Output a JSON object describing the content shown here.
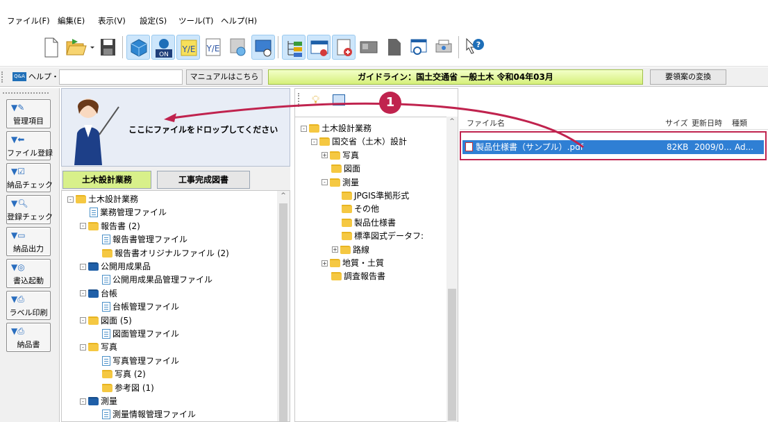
{
  "menu": [
    "ファイル(F)",
    "編集(E)",
    "表示(V)",
    "設定(S)",
    "ツール(T)",
    "ヘルプ(H)"
  ],
  "guidebar": {
    "help_label": "ヘルプ・FAQ検索",
    "qa_badge": "Q&A",
    "manual_button": "マニュアルはこちら",
    "guideline_text": "ガイドライン：国土交通省 一般土木 令和04年03月",
    "convert_button": "要領案の変換"
  },
  "sidebar": [
    {
      "label": "管理項目",
      "icon": "edit-icon"
    },
    {
      "label": "ファイル登録",
      "icon": "register-icon"
    },
    {
      "label": "納品チェック",
      "icon": "checkbox-icon"
    },
    {
      "label": "登録チェック",
      "icon": "magnifier-icon"
    },
    {
      "label": "納品出力",
      "icon": "drive-icon"
    },
    {
      "label": "書込起動",
      "icon": "disc-icon"
    },
    {
      "label": "ラベル印刷",
      "icon": "printer-icon"
    },
    {
      "label": "納品書",
      "icon": "printer-icon"
    }
  ],
  "drop": {
    "text": "ここにファイルをドロップしてください"
  },
  "tabs": [
    {
      "label": "土木設計業務",
      "active": true
    },
    {
      "label": "工事完成図書",
      "active": false
    }
  ],
  "left_tree": [
    {
      "label": "土木設計業務",
      "type": "folder",
      "indent": 0,
      "exp": "-"
    },
    {
      "label": "業務管理ファイル",
      "type": "doc",
      "indent": 1
    },
    {
      "label": "報告書 (2)",
      "type": "folder",
      "indent": 1,
      "exp": "-"
    },
    {
      "label": "報告書管理ファイル",
      "type": "doc",
      "indent": 2
    },
    {
      "label": "報告書オリジナルファイル (2)",
      "type": "folder",
      "indent": 2
    },
    {
      "label": "公開用成果品",
      "type": "folder-blue",
      "indent": 1,
      "exp": "-"
    },
    {
      "label": "公開用成果品管理ファイル",
      "type": "doc",
      "indent": 2
    },
    {
      "label": "台帳",
      "type": "folder-blue",
      "indent": 1,
      "exp": "-"
    },
    {
      "label": "台帳管理ファイル",
      "type": "doc",
      "indent": 2
    },
    {
      "label": "図面 (5)",
      "type": "folder",
      "indent": 1,
      "exp": "-"
    },
    {
      "label": "図面管理ファイル",
      "type": "doc",
      "indent": 2
    },
    {
      "label": "写真",
      "type": "folder",
      "indent": 1,
      "exp": "-"
    },
    {
      "label": "写真管理ファイル",
      "type": "doc",
      "indent": 2
    },
    {
      "label": "写真 (2)",
      "type": "folder",
      "indent": 2
    },
    {
      "label": "参考図 (1)",
      "type": "folder",
      "indent": 2
    },
    {
      "label": "測量",
      "type": "folder-blue",
      "indent": 1,
      "exp": "-"
    },
    {
      "label": "測量情報管理ファイル",
      "type": "doc",
      "indent": 2
    }
  ],
  "mid_tree": [
    {
      "label": "土木設計業務",
      "indent": 0,
      "exp": "-"
    },
    {
      "label": "国交省（土木）設計",
      "indent": 1,
      "exp": "-"
    },
    {
      "label": "写真",
      "indent": 2,
      "exp": "+"
    },
    {
      "label": "図面",
      "indent": 2
    },
    {
      "label": "測量",
      "indent": 2,
      "exp": "-"
    },
    {
      "label": "JPGIS準拠形式",
      "indent": 3
    },
    {
      "label": "その他",
      "indent": 3
    },
    {
      "label": "製品仕様書",
      "indent": 3
    },
    {
      "label": "標準図式データフ:",
      "indent": 3
    },
    {
      "label": "路線",
      "indent": 3,
      "exp": "+"
    },
    {
      "label": "地質・土質",
      "indent": 2,
      "exp": "+"
    },
    {
      "label": "調査報告書",
      "indent": 2
    }
  ],
  "file_list": {
    "headers": [
      "ファイル名",
      "サイズ",
      "更新日時",
      "種類"
    ],
    "rows": [
      {
        "name": "製品仕様書（サンプル）.pdf",
        "size": "82KB",
        "date": "2009/0...",
        "type": "Ad..."
      }
    ]
  },
  "callout": {
    "number": "1",
    "color": "#c0234e"
  }
}
